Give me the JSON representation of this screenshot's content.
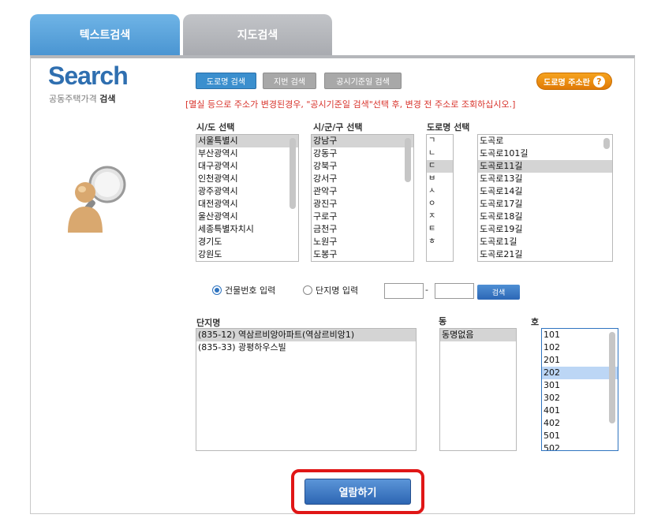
{
  "tabs": {
    "text_search": "텍스트검색",
    "map_search": "지도검색"
  },
  "header": {
    "title": "Search",
    "subtitle_plain": "공동주택가격",
    "subtitle_bold": "검색"
  },
  "sub_buttons": {
    "road": "도로명 검색",
    "lot": "지번 검색",
    "date": "공시기준일 검색"
  },
  "help": {
    "label": "도로명 주소란",
    "icon": "?"
  },
  "notice": "[멸실 등으로 주소가 변경된경우, \"공시기준일 검색\"선택 후, 변경 전 주소로 조회하십시오.]",
  "labels": {
    "sido": "시/도 선택",
    "sigungu": "시/군/구 선택",
    "road": "도로명 선택",
    "complex": "단지명",
    "dong": "동",
    "ho": "호"
  },
  "sido": [
    "서울특별시",
    "부산광역시",
    "대구광역시",
    "인천광역시",
    "광주광역시",
    "대전광역시",
    "울산광역시",
    "세종특별자치시",
    "경기도",
    "강원도"
  ],
  "sigungu": [
    "강남구",
    "강동구",
    "강북구",
    "강서구",
    "관악구",
    "광진구",
    "구로구",
    "금천구",
    "노원구",
    "도봉구"
  ],
  "initials": [
    "ㄱ",
    "ㄴ",
    "ㄷ",
    "ㅂ",
    "ㅅ",
    "ㅇ",
    "ㅈ",
    "ㅌ",
    "ㅎ"
  ],
  "roads": [
    "도곡로",
    "도곡로101길",
    "도곡로11길",
    "도곡로13길",
    "도곡로14길",
    "도곡로17길",
    "도곡로18길",
    "도곡로19길",
    "도곡로1길",
    "도곡로21길"
  ],
  "radio": {
    "building": "건물번호 입력",
    "complex": "단지명 입력"
  },
  "search_btn": "검색",
  "dash": "-",
  "complexes": [
    "(835-12) 역삼르비앙아파트(역삼르비앙1)",
    "(835-33) 광평하우스빌"
  ],
  "dongs": [
    "동명없음"
  ],
  "hos": [
    "101",
    "102",
    "201",
    "202",
    "301",
    "302",
    "401",
    "402",
    "501",
    "502"
  ],
  "view_btn": "열람하기"
}
